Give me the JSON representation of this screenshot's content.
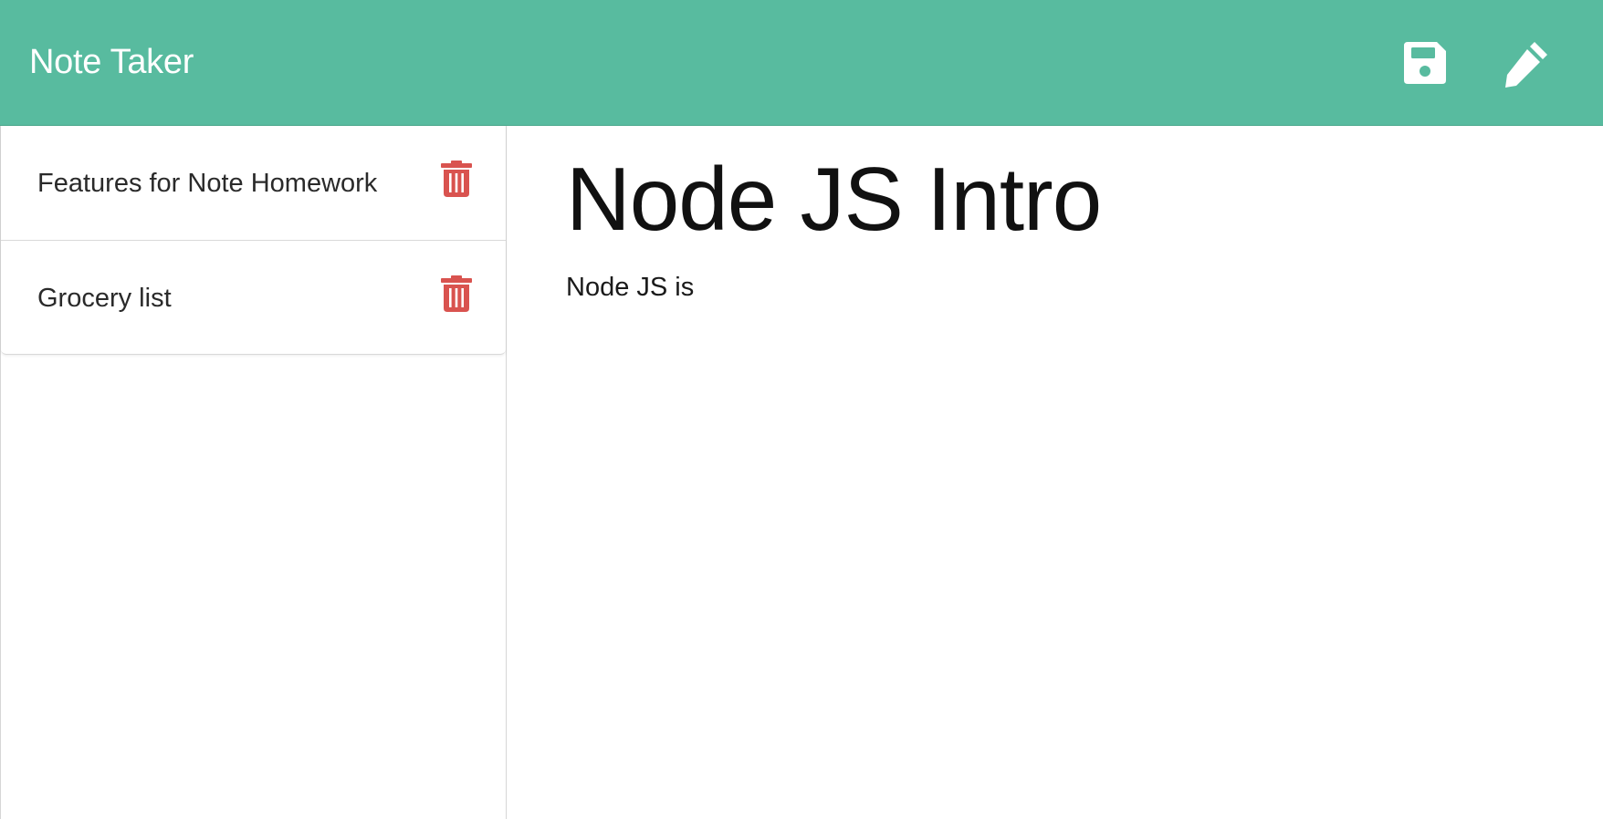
{
  "app": {
    "title": "Note Taker"
  },
  "toolbar": {
    "save_icon": "floppy-disk-icon",
    "new_note_icon": "pencil-icon"
  },
  "sidebar": {
    "notes": [
      {
        "title": "Features for Note Homework",
        "delete_icon": "trash-icon"
      },
      {
        "title": "Grocery list",
        "delete_icon": "trash-icon"
      }
    ]
  },
  "editor": {
    "title": "Node JS Intro",
    "text": "Node JS is"
  },
  "colors": {
    "navbar": "#58bb9f",
    "icon": "#ffffff",
    "delete": "#d9534f",
    "text": "#111111"
  }
}
